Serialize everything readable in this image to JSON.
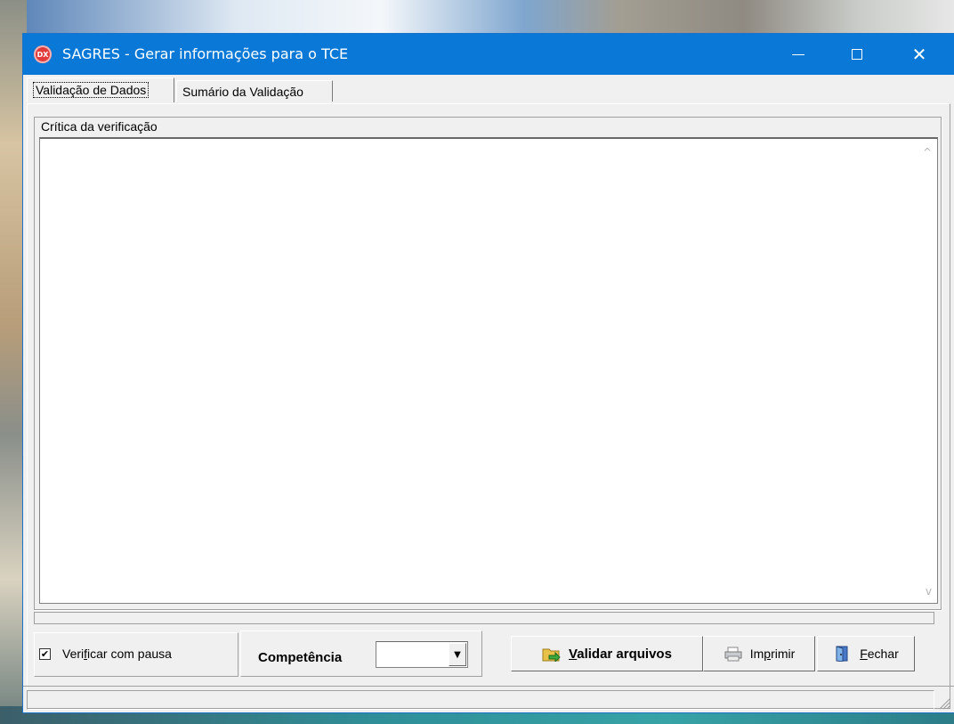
{
  "window": {
    "title": "SAGRES - Gerar informações para o TCE",
    "icon_text": "DX"
  },
  "tabs": [
    {
      "label": "Validação de Dados",
      "active": true
    },
    {
      "label": "Sumário da Validação",
      "active": false
    }
  ],
  "group": {
    "label": "Crítica da verificação"
  },
  "controls": {
    "checkbox": {
      "label_pre": "Veri",
      "label_u": "f",
      "label_post": "icar com pausa",
      "checked": true,
      "mark": "✔"
    },
    "competencia_label": "Competência",
    "competencia_value": "",
    "combo_arrow": "▼"
  },
  "buttons": {
    "validar": {
      "u": "V",
      "rest": "alidar arquivos",
      "icon": "folder-arrow-icon"
    },
    "imprimir": {
      "pre": "Im",
      "u": "p",
      "post": "rimir",
      "icon": "printer-icon"
    },
    "fechar": {
      "u": "F",
      "rest": "echar",
      "icon": "door-icon"
    }
  },
  "titlebar": {
    "close_glyph": "✕"
  },
  "memo": {
    "scroll_up": "^",
    "scroll_down": "v"
  }
}
